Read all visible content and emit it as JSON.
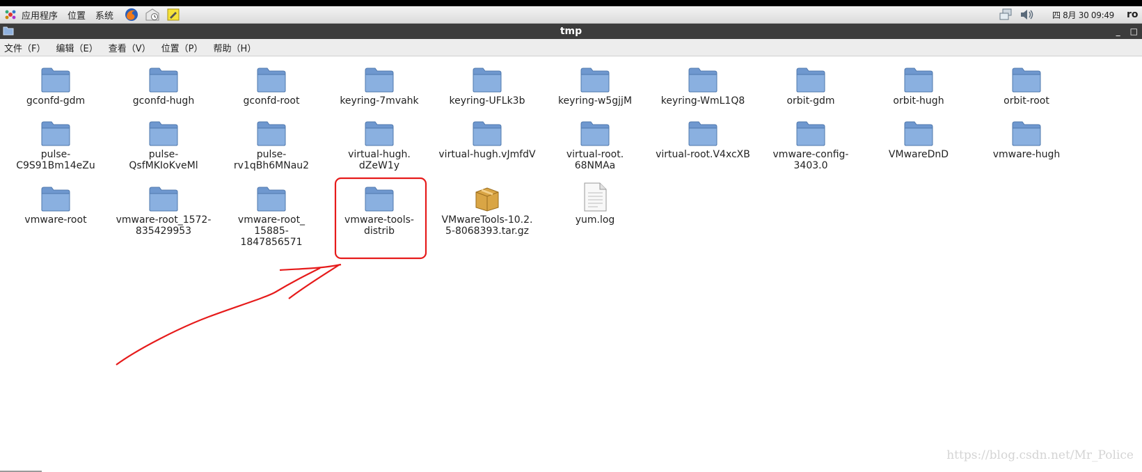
{
  "panel": {
    "menus": [
      "应用程序",
      "位置",
      "系统"
    ],
    "clock": "四 8月 30 09:49",
    "user": "ro"
  },
  "window": {
    "title": "tmp",
    "minimize": "_",
    "maximize": "□"
  },
  "menubar": {
    "items": [
      "文件（F）",
      "编辑（E）",
      "查看（V）",
      "位置（P）",
      "帮助（H）"
    ]
  },
  "files": [
    {
      "name": "gconfd-gdm",
      "type": "folder"
    },
    {
      "name": "gconfd-hugh",
      "type": "folder"
    },
    {
      "name": "gconfd-root",
      "type": "folder"
    },
    {
      "name": "keyring-7mvahk",
      "type": "folder"
    },
    {
      "name": "keyring-UFLk3b",
      "type": "folder"
    },
    {
      "name": "keyring-w5gjjM",
      "type": "folder"
    },
    {
      "name": "keyring-WmL1Q8",
      "type": "folder"
    },
    {
      "name": "orbit-gdm",
      "type": "folder"
    },
    {
      "name": "orbit-hugh",
      "type": "folder"
    },
    {
      "name": "orbit-root",
      "type": "folder"
    },
    {
      "name": "pulse-\nC9S91Bm14eZu",
      "type": "folder"
    },
    {
      "name": "pulse-\nQsfMKIoKveMl",
      "type": "folder"
    },
    {
      "name": "pulse-\nrv1qBh6MNau2",
      "type": "folder"
    },
    {
      "name": "virtual-hugh.\ndZeW1y",
      "type": "folder"
    },
    {
      "name": "virtual-hugh.vJmfdV",
      "type": "folder"
    },
    {
      "name": "virtual-root.\n68NMAa",
      "type": "folder"
    },
    {
      "name": "virtual-root.V4xcXB",
      "type": "folder"
    },
    {
      "name": "vmware-config-\n3403.0",
      "type": "folder"
    },
    {
      "name": "VMwareDnD",
      "type": "folder"
    },
    {
      "name": "vmware-hugh",
      "type": "folder"
    },
    {
      "name": "vmware-root",
      "type": "folder"
    },
    {
      "name": "vmware-root_1572-\n835429953",
      "type": "folder"
    },
    {
      "name": "vmware-root_\n15885-\n1847856571",
      "type": "folder"
    },
    {
      "name": "vmware-tools-\ndistrib",
      "type": "folder"
    },
    {
      "name": "VMwareTools-10.2.\n5-8068393.tar.gz",
      "type": "archive"
    },
    {
      "name": "yum.log",
      "type": "text"
    }
  ],
  "watermark": "https://blog.csdn.net/Mr_Police",
  "colors": {
    "annotation": "#e61b1b",
    "folder": "#7ba4d8",
    "titlebar": "#3c3c3c"
  }
}
